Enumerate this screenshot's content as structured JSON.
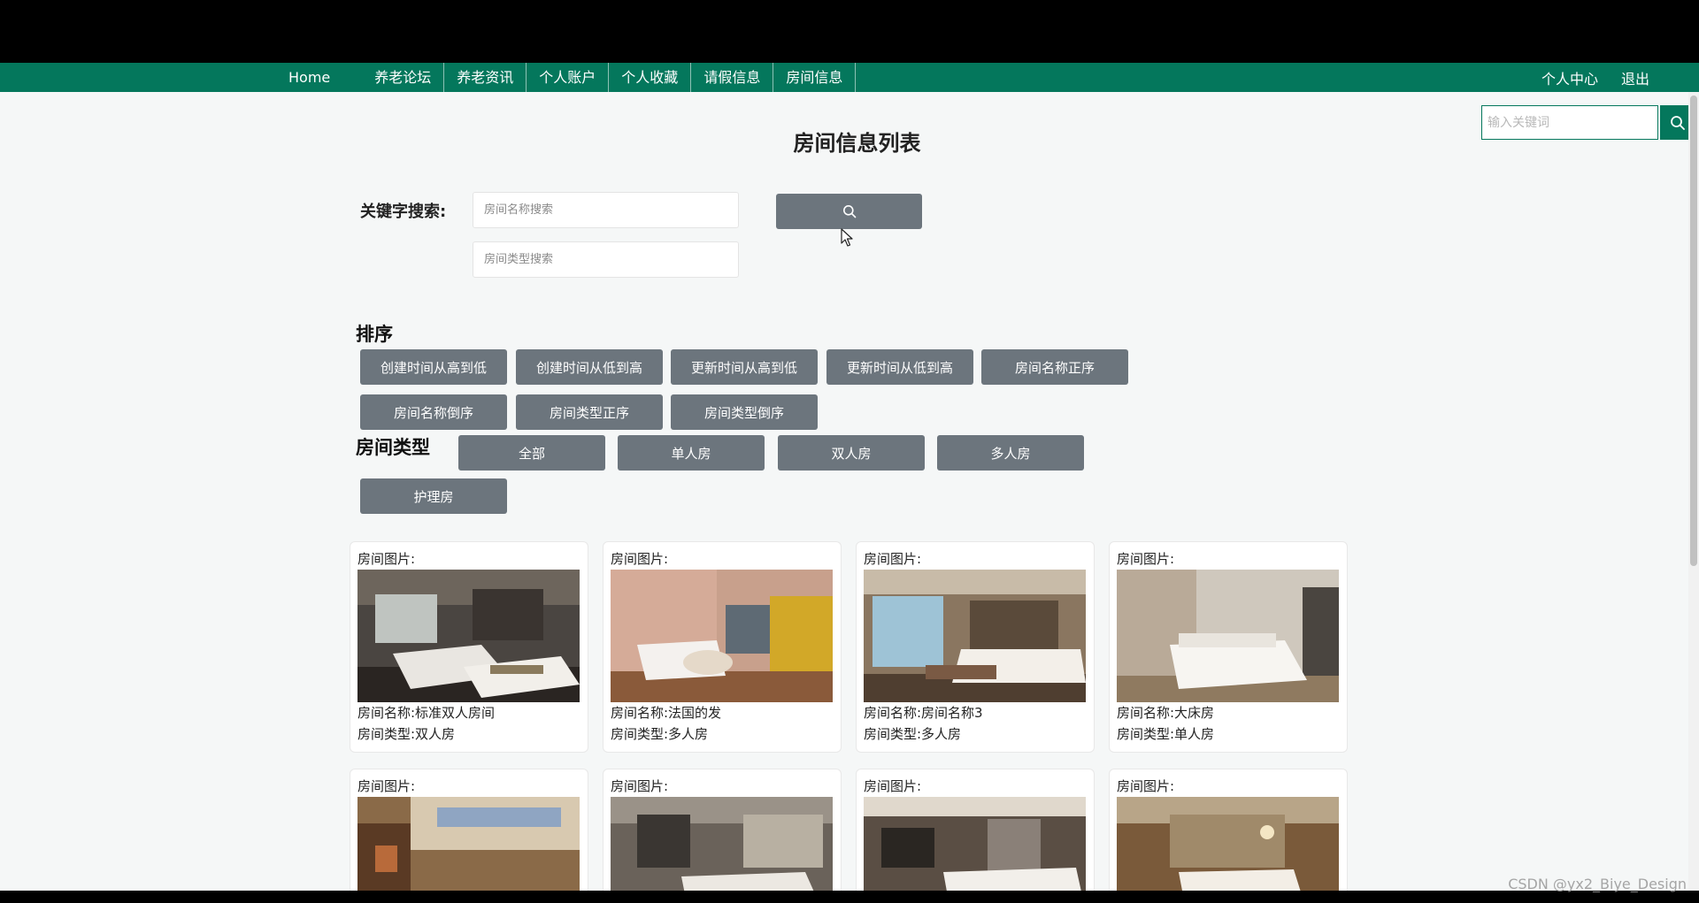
{
  "nav": {
    "home": "Home",
    "items": [
      "养老论坛",
      "养老资讯",
      "个人账户",
      "个人收藏",
      "请假信息",
      "房间信息"
    ],
    "right": [
      "个人中心",
      "退出"
    ]
  },
  "global_search": {
    "placeholder": "输入关键词"
  },
  "page_title": "房间信息列表",
  "keyword_search": {
    "label": "关键字搜索:",
    "name_placeholder": "房间名称搜索",
    "type_placeholder": "房间类型搜索"
  },
  "sort": {
    "label": "排序",
    "options": [
      "创建时间从高到低",
      "创建时间从低到高",
      "更新时间从高到低",
      "更新时间从低到高",
      "房间名称正序",
      "房间名称倒序",
      "房间类型正序",
      "房间类型倒序"
    ]
  },
  "room_type": {
    "label": "房间类型",
    "options": [
      "全部",
      "单人房",
      "双人房",
      "多人房",
      "护理房"
    ]
  },
  "cards": [
    {
      "image_label": "房间图片:",
      "name": "房间名称:标准双人房间",
      "type": "房间类型:双人房"
    },
    {
      "image_label": "房间图片:",
      "name": "房间名称:法国的发",
      "type": "房间类型:多人房"
    },
    {
      "image_label": "房间图片:",
      "name": "房间名称:房间名称3",
      "type": "房间类型:多人房"
    },
    {
      "image_label": "房间图片:",
      "name": "房间名称:大床房",
      "type": "房间类型:单人房"
    },
    {
      "image_label": "房间图片:"
    },
    {
      "image_label": "房间图片:"
    },
    {
      "image_label": "房间图片:"
    },
    {
      "image_label": "房间图片:"
    }
  ],
  "watermark": "CSDN @yx2_Biye_Design",
  "colors": {
    "nav": "#04775c",
    "button": "#6c757d",
    "background": "#f5f7f7"
  }
}
